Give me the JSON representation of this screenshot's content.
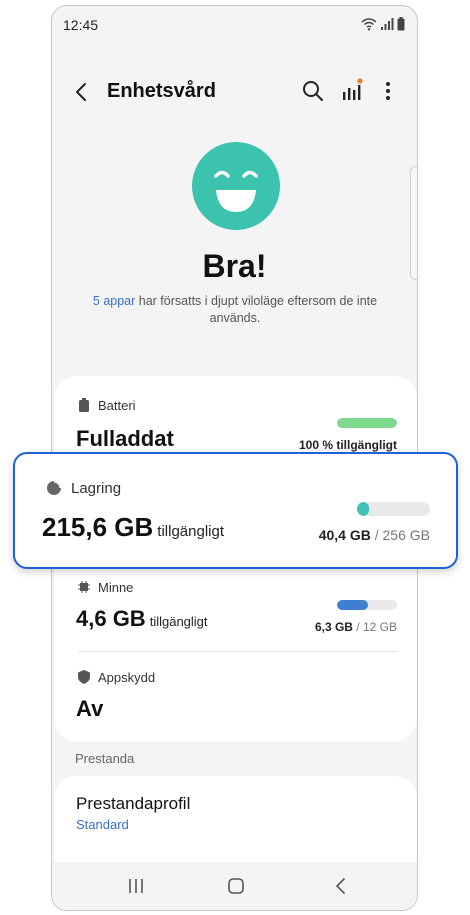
{
  "status_bar": {
    "time": "12:45"
  },
  "app_bar": {
    "title": "Enhetsvård",
    "icons": [
      "back-arrow-icon",
      "search-icon",
      "bar-chart-icon",
      "more-vert-icon"
    ],
    "notification_dot_color": "#f07a2c"
  },
  "summary": {
    "face_color": "#3cc3ad",
    "title": "Bra!",
    "desc_link": "5 appar",
    "desc_rest": " har försatts i djupt viloläge eftersom de inte används."
  },
  "rows": {
    "battery": {
      "label": "Batteri",
      "value": "Fulladdat",
      "caption": "100 % tillgängligt",
      "fill_fraction": 1.0,
      "color": "#7ed98e"
    },
    "storage": {
      "label": "Lagring",
      "value": "215,6 GB",
      "unit": "tillgängligt",
      "used": "40,4 GB",
      "separator": " / ",
      "total": "256 GB",
      "fill_fraction": 0.16,
      "color": "#40c1b4"
    },
    "memory": {
      "label": "Minne",
      "value": "4,6 GB",
      "unit": "tillgängligt",
      "used": "6,3 GB",
      "separator": " / ",
      "total": "12 GB",
      "fill_fraction": 0.52,
      "color": "#3f7fd0"
    },
    "app_protection": {
      "label": "Appskydd",
      "value": "Av"
    }
  },
  "performance": {
    "section_header": "Prestanda",
    "profile_title": "Prestandaprofil",
    "profile_value": "Standard"
  },
  "nav_bar": {
    "icons": [
      "recents-icon",
      "home-icon",
      "back-icon"
    ]
  },
  "colors": {
    "accent": "#1f62d6",
    "link": "#3a6fc4"
  }
}
